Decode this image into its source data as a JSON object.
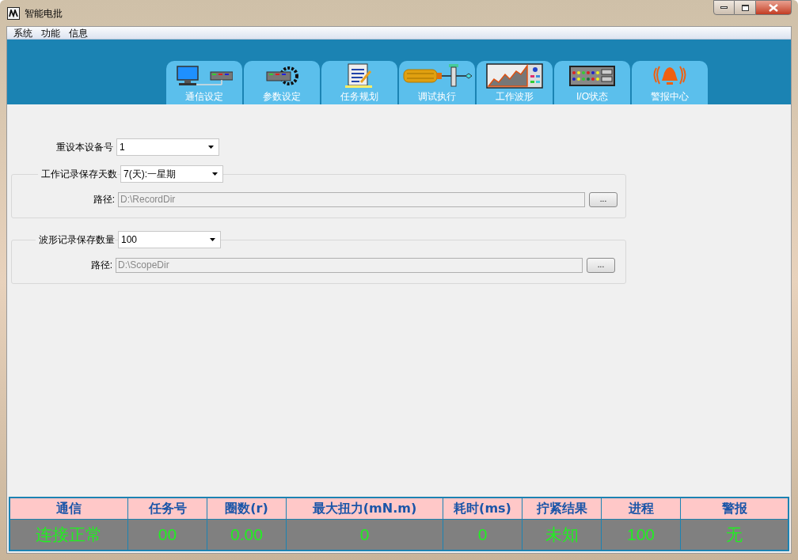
{
  "window": {
    "title": "智能电批"
  },
  "menu": [
    "系统",
    "功能",
    "信息"
  ],
  "tabs": [
    {
      "label": "通信设定",
      "kind": "network",
      "selected": false
    },
    {
      "label": "参数设定",
      "kind": "gear",
      "selected": false
    },
    {
      "label": "任务规划",
      "kind": "document",
      "selected": false
    },
    {
      "label": "调试执行",
      "kind": "screwdriver",
      "selected": false
    },
    {
      "label": "工作波形",
      "kind": "chart",
      "selected": false
    },
    {
      "label": "I/O状态",
      "kind": "panel",
      "selected": false
    },
    {
      "label": "警报中心",
      "kind": "alarm",
      "selected": false
    }
  ],
  "device": {
    "label": "重设本设备号",
    "value": "1"
  },
  "groups": [
    {
      "label": "工作记录保存天数",
      "value": "7(天):一星期",
      "path_label": "路径:",
      "path": "D:\\RecordDir",
      "browse": "..."
    },
    {
      "label": "波形记录保存数量",
      "value": "100",
      "path_label": "路径:",
      "path": "D:\\ScopeDir",
      "browse": "..."
    }
  ],
  "status": {
    "columns": [
      "通信",
      "任务号",
      "圈数(r)",
      "最大扭力(mN.m)",
      "耗时(ms)",
      "拧紧结果",
      "进程",
      "警报"
    ],
    "values": [
      "连接正常",
      "00",
      "0.00",
      "0",
      "0",
      "未知",
      "100",
      "无"
    ]
  }
}
